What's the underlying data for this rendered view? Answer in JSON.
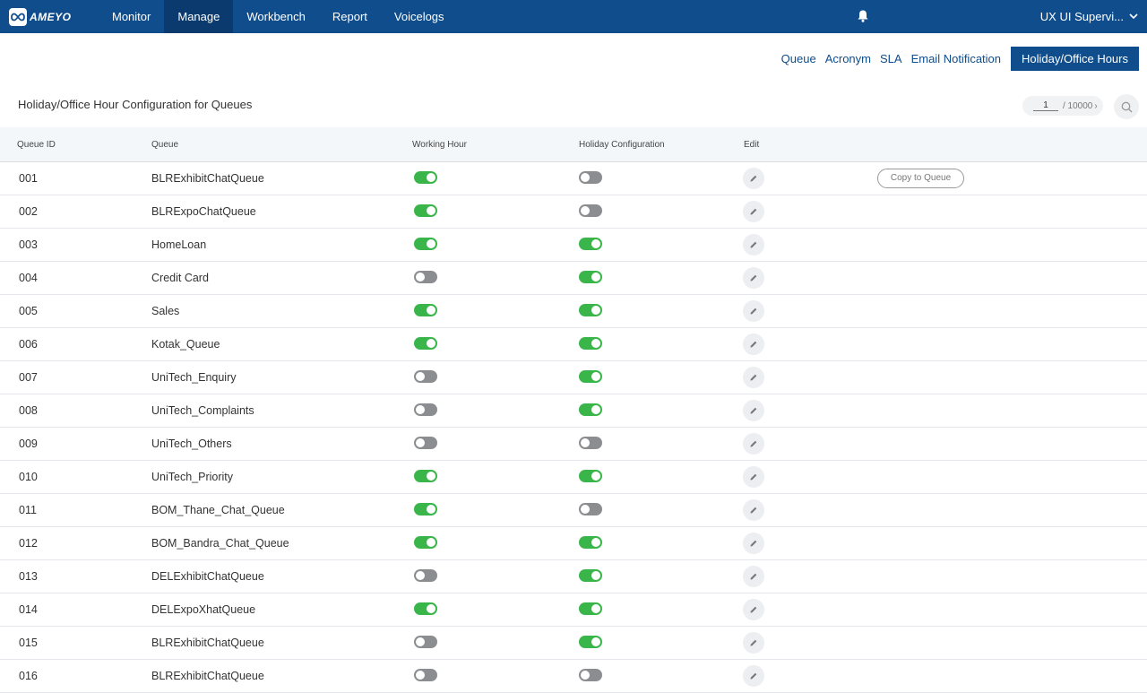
{
  "app": {
    "logo_text": "AMEYO"
  },
  "nav": {
    "items": [
      {
        "label": "Monitor",
        "active": false
      },
      {
        "label": "Manage",
        "active": true
      },
      {
        "label": "Workbench",
        "active": false
      },
      {
        "label": "Report",
        "active": false
      },
      {
        "label": "Voicelogs",
        "active": false
      }
    ]
  },
  "user": {
    "name": "UX UI Supervi..."
  },
  "subnav": {
    "items": [
      {
        "label": "Queue",
        "active": false
      },
      {
        "label": "Acronym",
        "active": false
      },
      {
        "label": "SLA",
        "active": false
      },
      {
        "label": "Email Notification",
        "active": false
      },
      {
        "label": "Holiday/Office Hours",
        "active": true
      }
    ]
  },
  "page": {
    "title": "Holiday/Office Hour Configuration for Queues",
    "pager": {
      "current": "1",
      "total": "/ 10000",
      "next": "›"
    }
  },
  "table": {
    "headers": {
      "queue_id": "Queue ID",
      "queue": "Queue",
      "working_hour": "Working Hour",
      "holiday_configuration": "Holiday Configuration",
      "edit": "Edit"
    },
    "copy_label": "Copy to Queue",
    "rows": [
      {
        "id": "001",
        "queue": "BLRExhibitChatQueue",
        "working": true,
        "holiday": false,
        "copy": true
      },
      {
        "id": "002",
        "queue": "BLRExpoChatQueue",
        "working": true,
        "holiday": false
      },
      {
        "id": "003",
        "queue": "HomeLoan",
        "working": true,
        "holiday": true
      },
      {
        "id": "004",
        "queue": "Credit Card",
        "working": false,
        "holiday": true
      },
      {
        "id": "005",
        "queue": "Sales",
        "working": true,
        "holiday": true
      },
      {
        "id": "006",
        "queue": "Kotak_Queue",
        "working": true,
        "holiday": true
      },
      {
        "id": "007",
        "queue": "UniTech_Enquiry",
        "working": false,
        "holiday": true
      },
      {
        "id": "008",
        "queue": "UniTech_Complaints",
        "working": false,
        "holiday": true
      },
      {
        "id": "009",
        "queue": "UniTech_Others",
        "working": false,
        "holiday": false
      },
      {
        "id": "010",
        "queue": "UniTech_Priority",
        "working": true,
        "holiday": true
      },
      {
        "id": "011",
        "queue": "BOM_Thane_Chat_Queue",
        "working": true,
        "holiday": false
      },
      {
        "id": "012",
        "queue": "BOM_Bandra_Chat_Queue",
        "working": true,
        "holiday": true
      },
      {
        "id": "013",
        "queue": "DELExhibitChatQueue",
        "working": false,
        "holiday": true
      },
      {
        "id": "014",
        "queue": "DELExpoXhatQueue",
        "working": true,
        "holiday": true
      },
      {
        "id": "015",
        "queue": "BLRExhibitChatQueue",
        "working": false,
        "holiday": true
      },
      {
        "id": "016",
        "queue": "BLRExhibitChatQueue",
        "working": false,
        "holiday": false
      }
    ]
  },
  "colors": {
    "brand": "#0f4d8c",
    "toggle_on": "#3ab54a",
    "toggle_off": "#8b8d90"
  }
}
